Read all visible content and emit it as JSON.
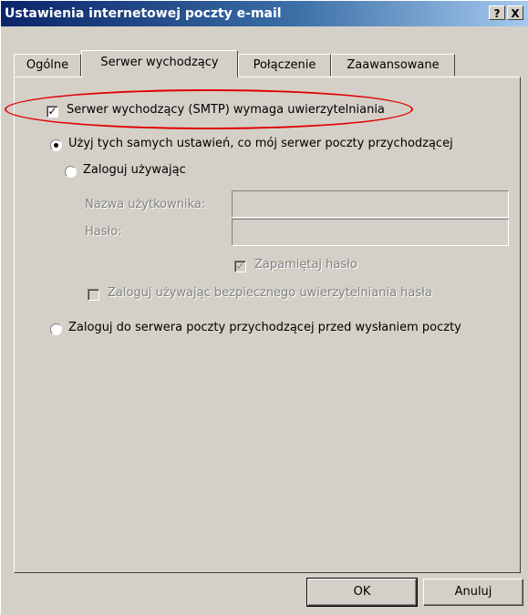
{
  "window": {
    "title": "Ustawienia internetowej poczty e-mail",
    "help_button": "?",
    "close_button": "X"
  },
  "tabs": [
    {
      "label": "Ogólne",
      "active": false
    },
    {
      "label": "Serwer wychodzący",
      "active": true
    },
    {
      "label": "Połączenie",
      "active": false
    },
    {
      "label": "Zaawansowane",
      "active": false
    }
  ],
  "smtp_auth": {
    "label": "Serwer wychodzący (SMTP) wymaga uwierzytelniania",
    "checked": true
  },
  "options": {
    "same_settings": {
      "label": "Użyj tych samych ustawień, co mój serwer poczty przychodzącej",
      "selected": true
    },
    "login_using": {
      "label": "Zaloguj używając",
      "selected": false
    },
    "username_label": "Nazwa użytkownika:",
    "username_value": "",
    "password_label": "Hasło:",
    "password_value": "",
    "remember_password": {
      "label": "Zapamiętaj hasło",
      "checked": true,
      "disabled": true
    },
    "secure_auth": {
      "label": "Zaloguj używając bezpiecznego uwierzytelniania hasła",
      "checked": false,
      "disabled": true
    },
    "login_before_send": {
      "label": "Zaloguj do serwera poczty przychodzącej przed wysłaniem poczty",
      "selected": false
    }
  },
  "buttons": {
    "ok": "OK",
    "cancel": "Anuluj"
  },
  "annotation": {
    "color": "#e00000",
    "shape": "ellipse"
  }
}
